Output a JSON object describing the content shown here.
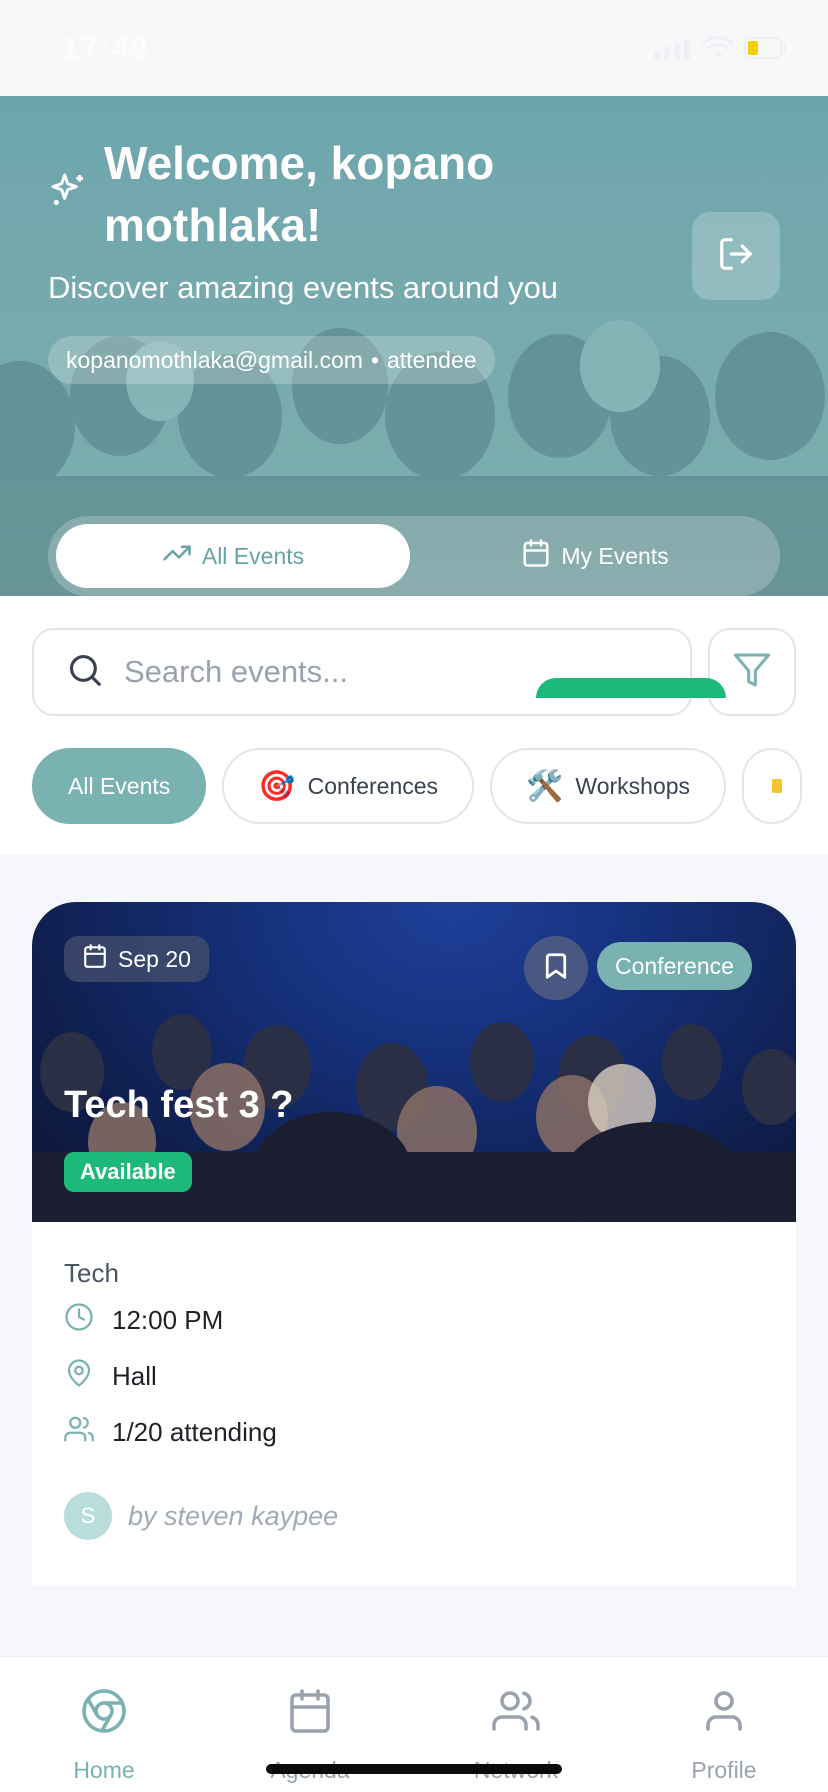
{
  "status_bar": {
    "time": "17:49"
  },
  "header": {
    "welcome_title": "Welcome, kopano mothlaka!",
    "subtitle": "Discover amazing events around you",
    "user_email": "kopanomothlaka@gmail.com",
    "separator": "•",
    "user_role": "attendee",
    "logout_icon": "logout-icon"
  },
  "segmented_tabs": [
    {
      "label": "All Events",
      "icon": "trending-up-icon",
      "active": true
    },
    {
      "label": "My Events",
      "icon": "calendar-icon",
      "active": false
    }
  ],
  "search": {
    "placeholder": "Search events...",
    "value": ""
  },
  "category_chips": [
    {
      "label": "All Events",
      "emoji": "",
      "active": true
    },
    {
      "label": "Conferences",
      "emoji": "🎯",
      "active": false
    },
    {
      "label": "Workshops",
      "emoji": "🛠️",
      "active": false
    }
  ],
  "event_card": {
    "date": "Sep 20",
    "category_badge": "Conference",
    "title": "Tech fest 3 ?",
    "availability": "Available",
    "category": "Tech",
    "time": "12:00 PM",
    "location": "Hall",
    "attendance": "1/20 attending",
    "organizer_initial": "S",
    "organizer": "by steven kaypee"
  },
  "bottom_nav": [
    {
      "label": "Home",
      "icon": "home-icon",
      "active": true
    },
    {
      "label": "Agenda",
      "icon": "calendar-icon",
      "active": false
    },
    {
      "label": "Network",
      "icon": "users-icon",
      "active": false
    },
    {
      "label": "Profile",
      "icon": "user-icon",
      "active": false
    }
  ],
  "colors": {
    "accent": "#7ab1b1",
    "success": "#1db97a",
    "hero": "#6ea5ad"
  }
}
